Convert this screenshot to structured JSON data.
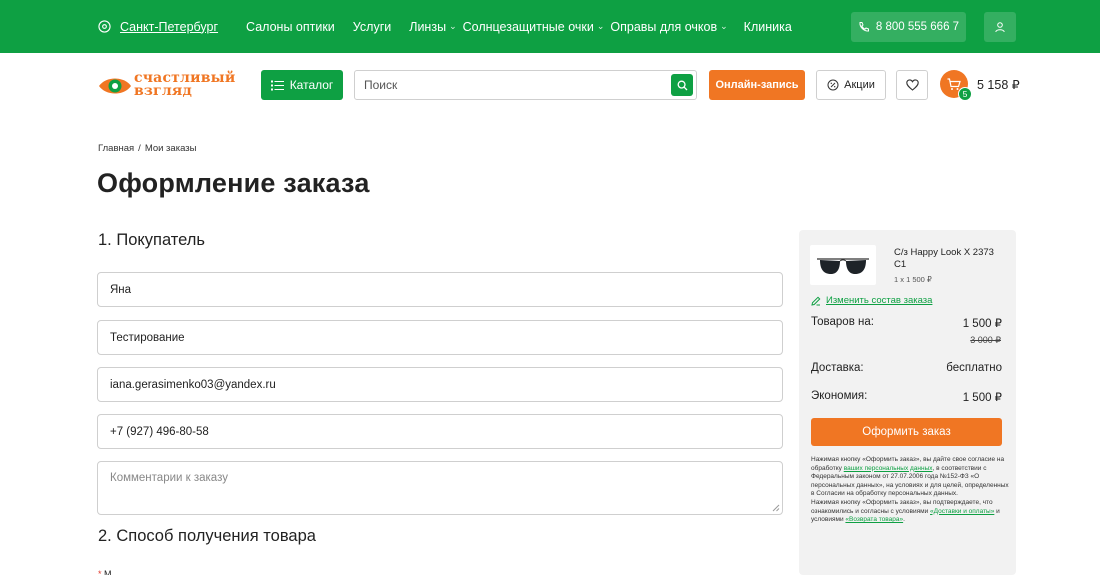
{
  "colors": {
    "brand_green": "#0ea043",
    "accent_orange": "#f07623"
  },
  "topbar": {
    "city": "Санкт-Петербург",
    "nav": [
      {
        "label": "Салоны оптики",
        "dropdown": false
      },
      {
        "label": "Услуги",
        "dropdown": false
      },
      {
        "label": "Линзы",
        "dropdown": true
      },
      {
        "label": "Солнцезащитные очки",
        "dropdown": true
      },
      {
        "label": "Оправы для очков",
        "dropdown": true
      },
      {
        "label": "Клиника",
        "dropdown": false
      }
    ],
    "phone": "8 800 555 666 7"
  },
  "header": {
    "logo_line1": "счастливый",
    "logo_line2": "взгляд",
    "catalog_label": "Каталог",
    "search_placeholder": "Поиск",
    "online_label": "Онлайн-запись",
    "promo_label": "Акции",
    "cart_count": "5",
    "cart_total": "5 158 ₽"
  },
  "breadcrumb": {
    "home": "Главная",
    "sep": "/",
    "current": "Мои заказы"
  },
  "page_title": "Оформление заказа",
  "buyer": {
    "heading": "1. Покупатель",
    "first_name": "Яна",
    "last_name": "Тестирование",
    "email": "iana.gerasimenko03@yandex.ru",
    "phone": "+7 (927) 496-80-58",
    "comment_placeholder": "Комментарии к заказу"
  },
  "delivery": {
    "heading": "2. Способ получения товара",
    "first_label_prefix": "*",
    "first_label": "М"
  },
  "summary": {
    "product_name": "С/з Happy Look X 2373 C1",
    "product_qty": "1 x 1 500 ₽",
    "edit_link": "Изменить состав заказа",
    "goods_label": "Товаров на:",
    "goods_value": "1 500 ₽",
    "goods_old": "3 000 ₽",
    "delivery_label": "Доставка:",
    "delivery_value": "бесплатно",
    "savings_label": "Экономия:",
    "savings_value": "1 500 ₽",
    "submit_label": "Оформить заказ",
    "legal_1": "Нажимая кнопку «Оформить заказ», вы дайте свое согласие на обработку ",
    "legal_link_1": "ваших персональных данных",
    "legal_2": ", в соответствии с Федеральным законом от 27.07.2006 года №152-ФЗ «О персональных данных», на условиях и для целей, определенных в Согласии на обработку персональных данных.",
    "legal_3": "Нажимая кнопку «Оформить заказ», вы подтверждаете, что ознакомились и согласны с условиями ",
    "legal_link_2": "«Доставки и оплаты»",
    "legal_4": " и условиями ",
    "legal_link_3": "«Возврата товара»",
    "legal_5": "."
  }
}
